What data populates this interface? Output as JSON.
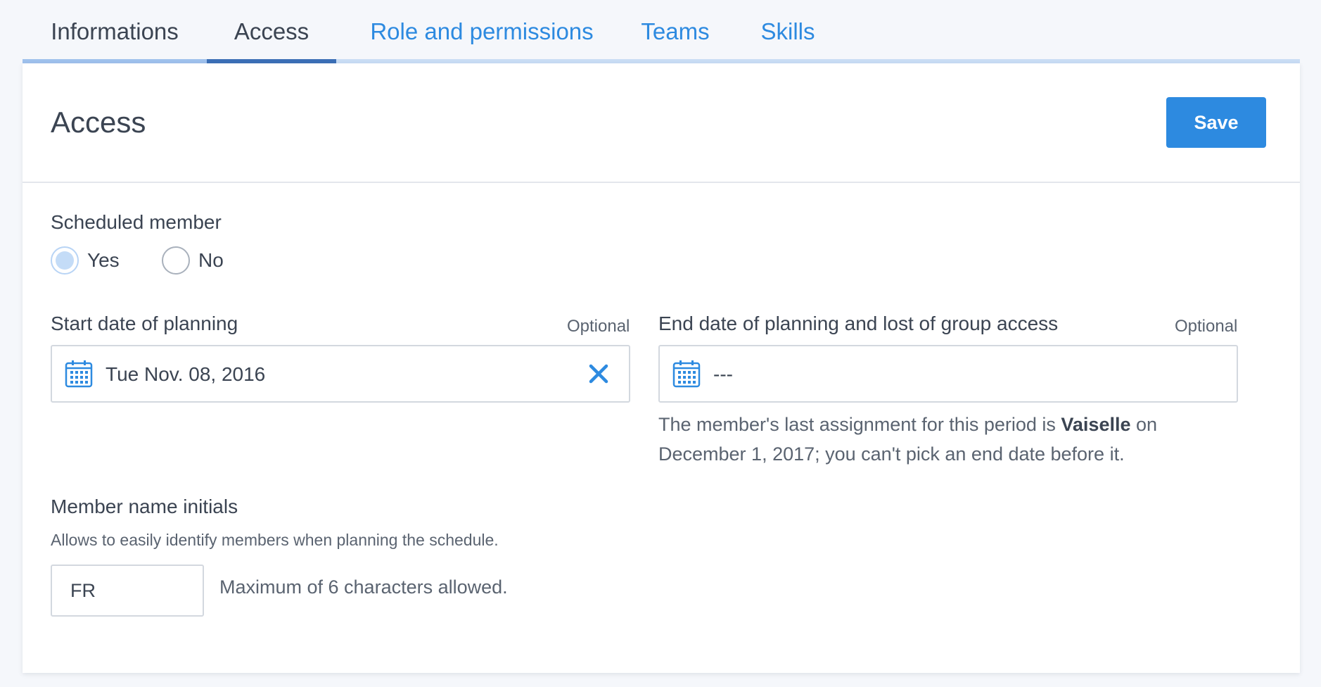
{
  "tabs": [
    {
      "label": "Informations"
    },
    {
      "label": "Access"
    },
    {
      "label": "Role and permissions"
    },
    {
      "label": "Teams"
    },
    {
      "label": "Skills"
    }
  ],
  "colors": {
    "accent": "#2d8ae0",
    "active_underline": "#3b6fb6",
    "underline_light": "#9fc1ec"
  },
  "header": {
    "title": "Access",
    "save_label": "Save"
  },
  "scheduled": {
    "label": "Scheduled member",
    "options": [
      {
        "label": "Yes",
        "checked": true
      },
      {
        "label": "No",
        "checked": false
      }
    ]
  },
  "start_date": {
    "label": "Start date of planning",
    "optional": "Optional",
    "value": "Tue Nov. 08, 2016"
  },
  "end_date": {
    "label": "End date of planning and lost of group access",
    "optional": "Optional",
    "value": "---",
    "help_pre": "The member's last assignment for this period is ",
    "help_bold": "Vaiselle",
    "help_post": " on",
    "help_line2": "December 1, 2017; you can't pick an end date before it."
  },
  "initials": {
    "label": "Member name initials",
    "help": "Allows to easily identify members when planning the schedule.",
    "value": "FR",
    "limit_note": "Maximum of 6 characters allowed."
  }
}
